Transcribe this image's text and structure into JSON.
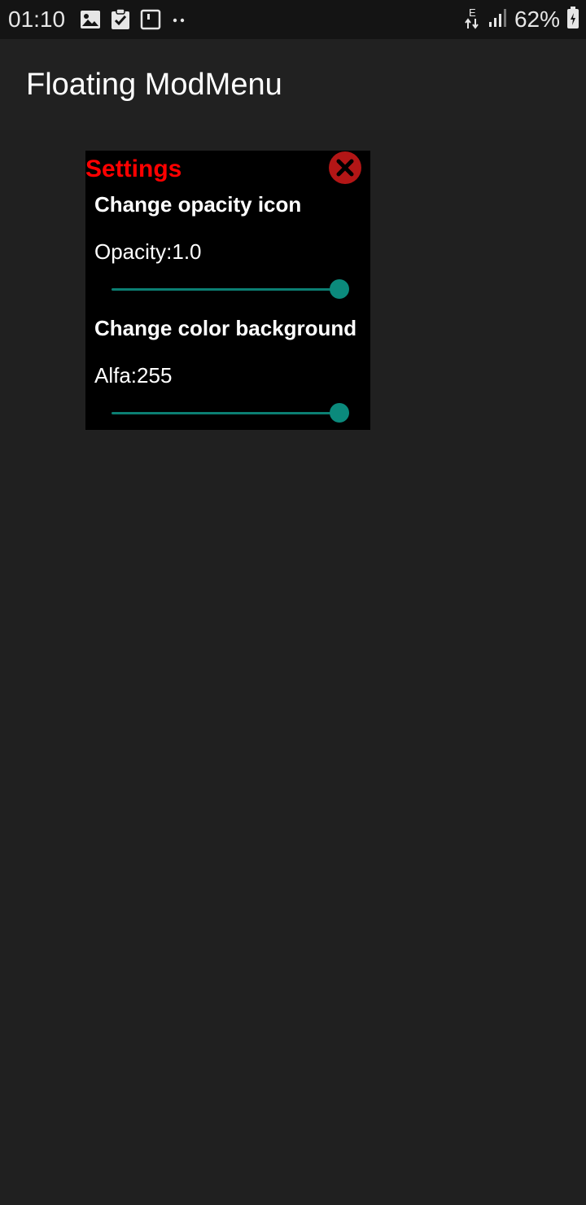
{
  "status_bar": {
    "time": "01:10",
    "battery_text": "62%",
    "left_icons": [
      "gallery-icon",
      "clipboard-check-icon",
      "square-notification-icon",
      "more-dots-icon"
    ],
    "right_icons": [
      "network-e-icon",
      "signal-icon",
      "battery-icon"
    ]
  },
  "app_bar": {
    "title": "Floating ModMenu"
  },
  "menu": {
    "title": "Settings",
    "title_color": "#ff0000",
    "close_icon": "close-circle-icon",
    "opacity_section": {
      "heading": "Change opacity icon",
      "value_label": "Opacity:1.0",
      "slider_value": 1.0
    },
    "color_section": {
      "heading": "Change color background",
      "value_label": "Alfa:255",
      "slider_value": 1.0
    },
    "accent_color": "#0b8a7c",
    "background_color": "#000000"
  },
  "page_background": "#202020"
}
